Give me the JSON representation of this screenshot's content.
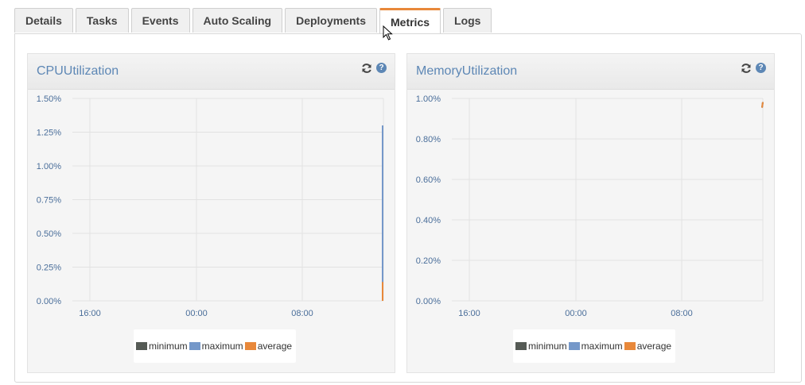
{
  "tabs": [
    {
      "label": "Details",
      "active": false
    },
    {
      "label": "Tasks",
      "active": false
    },
    {
      "label": "Events",
      "active": false
    },
    {
      "label": "Auto Scaling",
      "active": false
    },
    {
      "label": "Deployments",
      "active": false
    },
    {
      "label": "Metrics",
      "active": true
    },
    {
      "label": "Logs",
      "active": false
    }
  ],
  "colors": {
    "minimum": "#555a55",
    "maximum": "#7598c9",
    "average": "#e8883a",
    "title": "#5d87b5",
    "tab_accent": "#e8883a"
  },
  "legend": [
    {
      "label": "minimum",
      "color": "#555a55"
    },
    {
      "label": "maximum",
      "color": "#7598c9"
    },
    {
      "label": "average",
      "color": "#e8883a"
    }
  ],
  "icons": [
    "refresh-icon",
    "help-icon",
    "mouse-cursor-icon"
  ],
  "widgets": [
    {
      "title": "CPUUtilization",
      "chart_data": {
        "type": "line",
        "title": "CPUUtilization",
        "xlabel": "",
        "ylabel": "",
        "x_tick_labels": [
          "16:00",
          "00:00",
          "08:00"
        ],
        "y_tick_labels": [
          "1.50%",
          "1.25%",
          "1.00%",
          "0.75%",
          "0.50%",
          "0.25%",
          "0.00%"
        ],
        "ylim": [
          0,
          1.5
        ],
        "y_unit": "%",
        "grid": true,
        "legend_position": "bottom",
        "series": [
          {
            "name": "minimum",
            "points": []
          },
          {
            "name": "maximum",
            "points": [
              {
                "x": "end",
                "y": 1.3
              }
            ]
          },
          {
            "name": "average",
            "points": [
              {
                "x": "end",
                "y": 0.14
              }
            ]
          }
        ]
      }
    },
    {
      "title": "MemoryUtilization",
      "chart_data": {
        "type": "line",
        "title": "MemoryUtilization",
        "xlabel": "",
        "ylabel": "",
        "x_tick_labels": [
          "16:00",
          "00:00",
          "08:00"
        ],
        "y_tick_labels": [
          "1.00%",
          "0.80%",
          "0.60%",
          "0.40%",
          "0.20%",
          "0.00%"
        ],
        "ylim": [
          0,
          1.0
        ],
        "y_unit": "%",
        "grid": true,
        "legend_position": "bottom",
        "series": [
          {
            "name": "minimum",
            "points": [
              {
                "x": "end",
                "y": 0.97
              }
            ]
          },
          {
            "name": "maximum",
            "points": []
          },
          {
            "name": "average",
            "points": [
              {
                "x": "end",
                "y": 0.97
              }
            ]
          }
        ]
      }
    }
  ]
}
